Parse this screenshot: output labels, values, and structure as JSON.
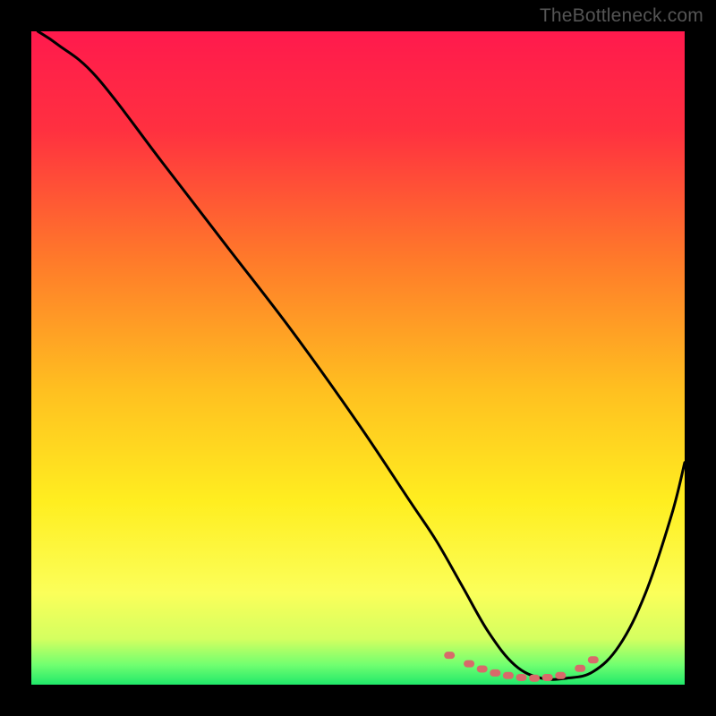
{
  "watermark": "TheBottleneck.com",
  "chart_data": {
    "type": "line",
    "title": "",
    "xlabel": "",
    "ylabel": "",
    "xlim": [
      0,
      100
    ],
    "ylim": [
      0,
      100
    ],
    "gradient_stops": [
      {
        "offset": 0.0,
        "color": "#ff1a4d"
      },
      {
        "offset": 0.15,
        "color": "#ff3040"
      },
      {
        "offset": 0.35,
        "color": "#ff7a2a"
      },
      {
        "offset": 0.55,
        "color": "#ffc020"
      },
      {
        "offset": 0.72,
        "color": "#ffee20"
      },
      {
        "offset": 0.86,
        "color": "#fbff5a"
      },
      {
        "offset": 0.93,
        "color": "#d4ff60"
      },
      {
        "offset": 0.97,
        "color": "#70ff70"
      },
      {
        "offset": 1.0,
        "color": "#20e86a"
      }
    ],
    "series": [
      {
        "name": "bottleneck-curve",
        "x": [
          1,
          4,
          10,
          20,
          30,
          40,
          50,
          58,
          62,
          66,
          70,
          74,
          78,
          82,
          86,
          90,
          94,
          98,
          100
        ],
        "y": [
          100,
          98,
          93,
          80,
          67,
          54,
          40,
          28,
          22,
          15,
          8,
          3,
          1,
          1,
          2,
          6,
          14,
          26,
          34
        ]
      }
    ],
    "markers": {
      "name": "highlight-dots",
      "color": "#d86a6a",
      "x": [
        64,
        67,
        69,
        71,
        73,
        75,
        77,
        79,
        81,
        84,
        86
      ],
      "y": [
        4.5,
        3.2,
        2.4,
        1.8,
        1.4,
        1.1,
        1.0,
        1.1,
        1.4,
        2.5,
        3.8
      ]
    }
  }
}
